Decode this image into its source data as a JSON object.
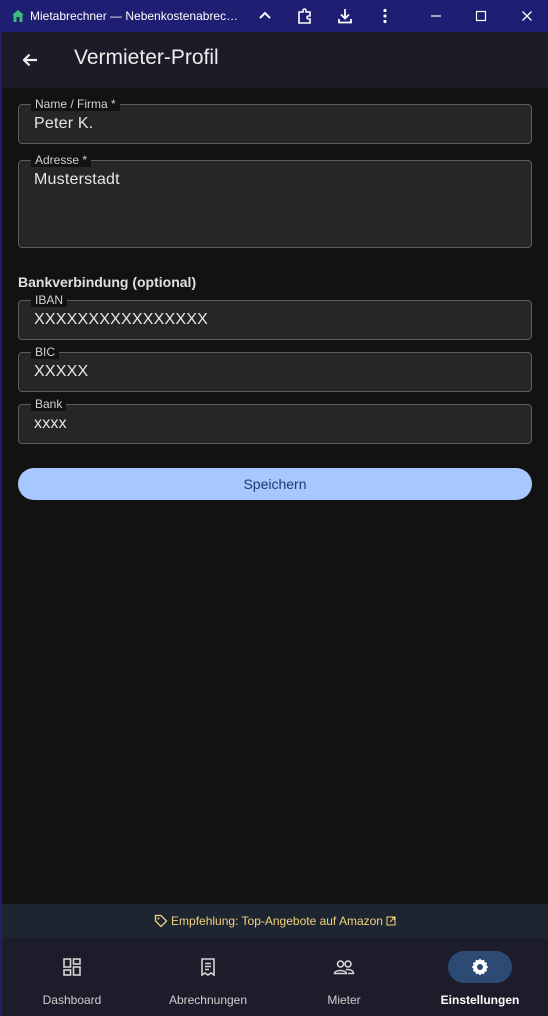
{
  "window": {
    "title": "Mietabrechner — Nebenkostenabrec…"
  },
  "appbar": {
    "title": "Vermieter-Profil"
  },
  "form": {
    "name": {
      "label": "Name / Firma *",
      "value": "Peter K."
    },
    "address": {
      "label": "Adresse *",
      "value": "Musterstadt"
    },
    "bank_section_title": "Bankverbindung (optional)",
    "iban": {
      "label": "IBAN",
      "value": "XXXXXXXXXXXXXXXX"
    },
    "bic": {
      "label": "BIC",
      "value": "XXXXX"
    },
    "bank": {
      "label": "Bank",
      "value": "xxxx"
    },
    "save_label": "Speichern"
  },
  "promo": {
    "text": "Empfehlung: Top-Angebote auf Amazon",
    "color": "#f2d27a"
  },
  "nav": {
    "items": [
      {
        "label": "Dashboard",
        "icon": "dashboard-icon",
        "active": false
      },
      {
        "label": "Abrechnungen",
        "icon": "receipt-icon",
        "active": false
      },
      {
        "label": "Mieter",
        "icon": "people-icon",
        "active": false
      },
      {
        "label": "Einstellungen",
        "icon": "gear-icon",
        "active": true
      }
    ]
  },
  "colors": {
    "accent": "#a7c8ff",
    "titlebar": "#1e1e72",
    "background": "#121212"
  }
}
